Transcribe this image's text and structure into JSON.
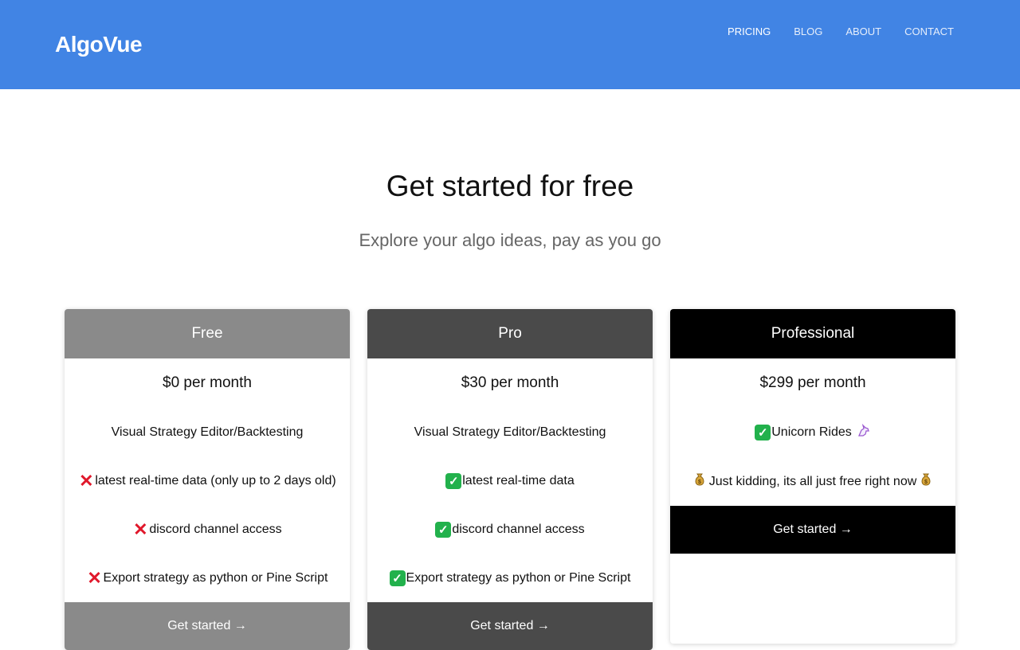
{
  "header": {
    "logo": "AlgoVue",
    "nav": [
      "PRICING",
      "BLOG",
      "ABOUT",
      "CONTACT"
    ]
  },
  "hero": {
    "title": "Get started for free",
    "subtitle": "Explore your algo ideas, pay as you go"
  },
  "plans": [
    {
      "name": "Free",
      "price": "$0 per month",
      "features": [
        "Visual Strategy Editor/Backtesting",
        "latest real-time data (only up to 2 days old)",
        "discord channel access",
        "Export strategy as python or Pine Script"
      ],
      "cta": "Get started →",
      "color": "#8a8a8a"
    },
    {
      "name": "Pro",
      "price": "$30 per month",
      "features": [
        "Visual Strategy Editor/Backtesting",
        "latest real-time data",
        "discord channel access",
        "Export strategy as python or Pine Script"
      ],
      "cta": "Get started →",
      "color": "#4a4a4a"
    },
    {
      "name": "Professional",
      "price": "$299 per month",
      "features": [
        "Unicorn Rides",
        "Just kidding, its all just free right now"
      ],
      "cta": "Get started →",
      "color": "#000000"
    }
  ],
  "icons": {
    "cross": "cross-mark-icon",
    "check": "check-mark-icon",
    "unicorn": "unicorn-icon",
    "money": "money-bag-icon"
  },
  "colors": {
    "header_bg": "#4184e4",
    "cross": "#e0182b",
    "check": "#22b14c"
  }
}
